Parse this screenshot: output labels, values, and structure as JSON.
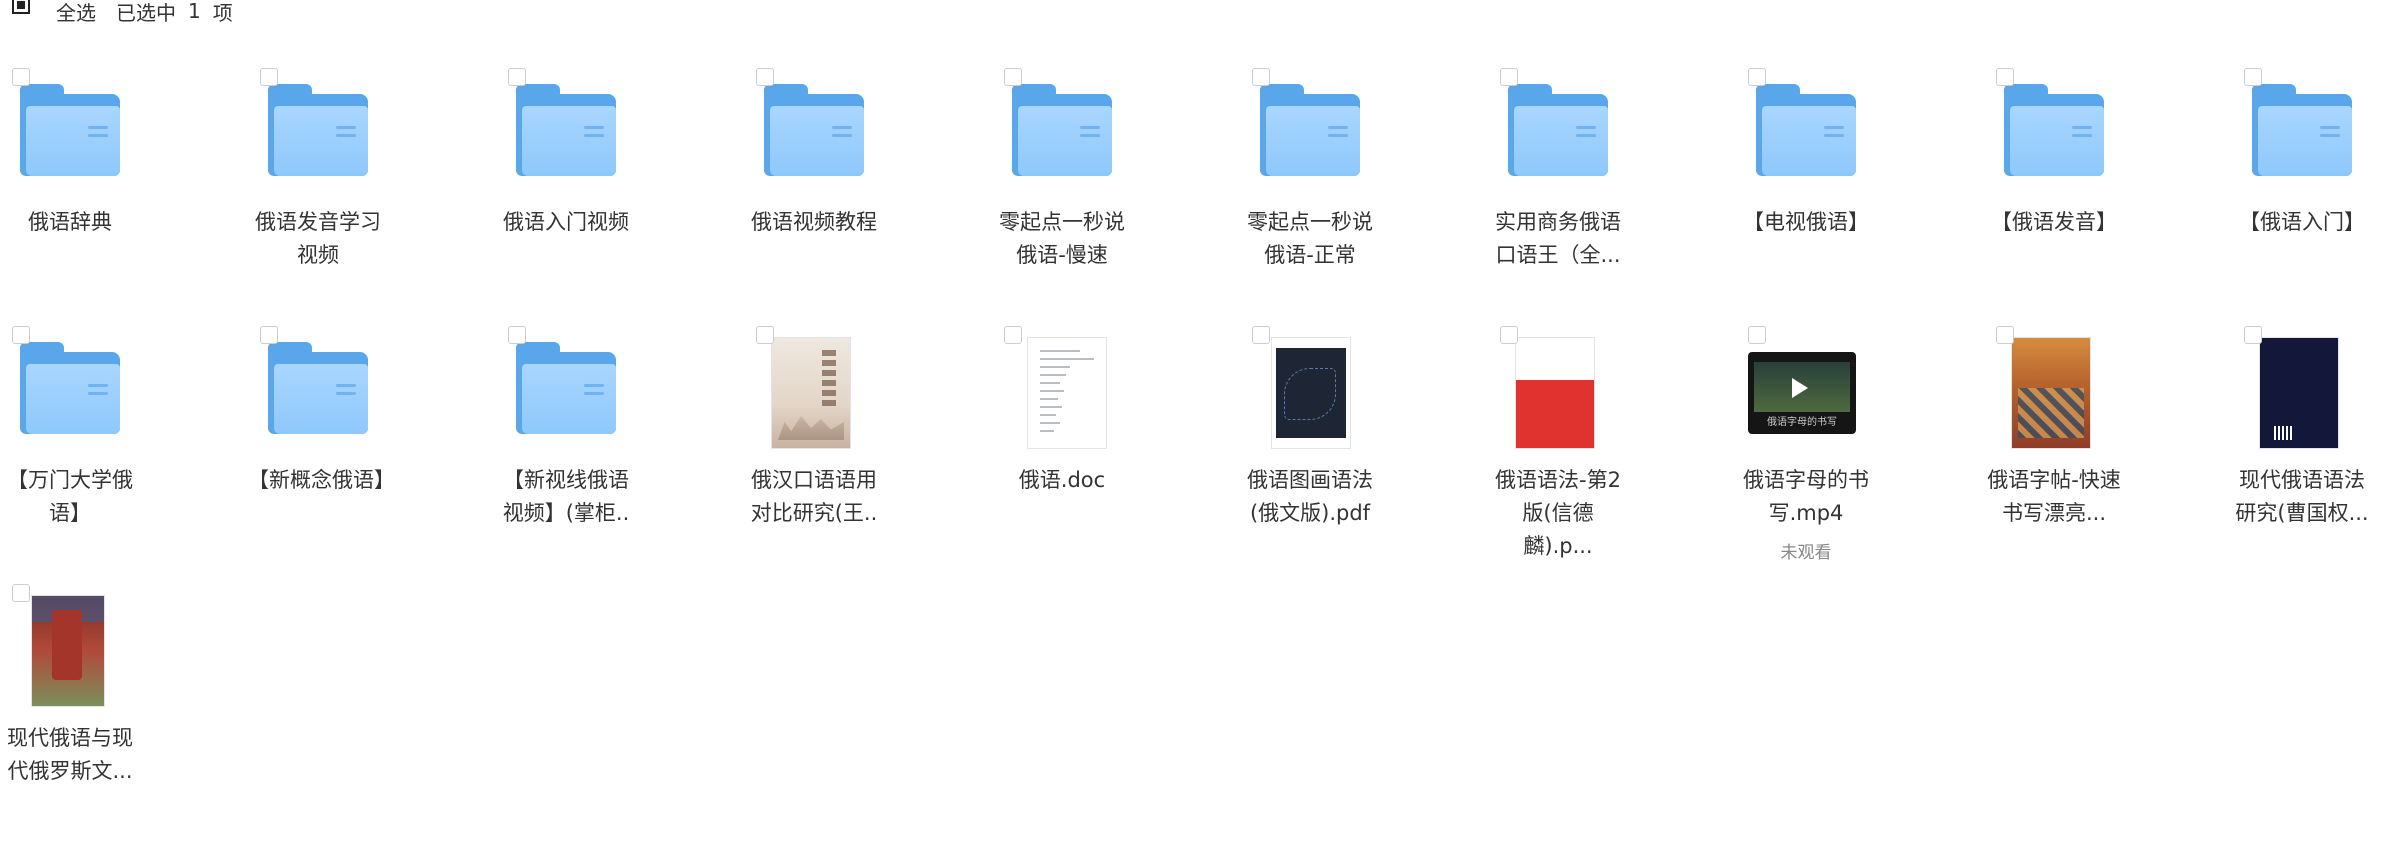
{
  "toolbar": {
    "select_all_label": "全选",
    "selected_text": "已选中",
    "selected_count": "1",
    "selected_unit": "项"
  },
  "items": [
    {
      "name": "俄语辞典",
      "type": "folder"
    },
    {
      "name": "俄语发音学习视频",
      "type": "folder"
    },
    {
      "name": "俄语入门视频",
      "type": "folder"
    },
    {
      "name": "俄语视频教程",
      "type": "folder"
    },
    {
      "name": "零起点一秒说俄语-慢速",
      "type": "folder"
    },
    {
      "name": "零起点一秒说俄语-正常",
      "type": "folder"
    },
    {
      "name": "实用商务俄语口语王（全...",
      "type": "folder"
    },
    {
      "name": "【电视俄语】",
      "type": "folder"
    },
    {
      "name": "【俄语发音】",
      "type": "folder"
    },
    {
      "name": "【俄语入门】",
      "type": "folder"
    },
    {
      "name": "【万门大学俄语】",
      "type": "folder"
    },
    {
      "name": "【新概念俄语】",
      "type": "folder"
    },
    {
      "name": "【新视线俄语视频】(掌柜..",
      "type": "folder"
    },
    {
      "name": "俄汉口语语用对比研究(王..",
      "type": "book"
    },
    {
      "name": "俄语.doc",
      "type": "doc"
    },
    {
      "name": "俄语图画语法(俄文版).pdf",
      "type": "pdf"
    },
    {
      "name": "俄语语法-第2版(信德麟).p...",
      "type": "grammar"
    },
    {
      "name": "俄语字母的书写.mp4",
      "type": "video",
      "sub": "未观看",
      "video_caption": "俄语字母的书写"
    },
    {
      "name": "俄语字帖-快速书写漂亮...",
      "type": "copybook"
    },
    {
      "name": "现代俄语语法研究(曹国权...",
      "type": "navy"
    },
    {
      "name": "现代俄语与现代俄罗斯文...",
      "type": "redbook"
    }
  ]
}
